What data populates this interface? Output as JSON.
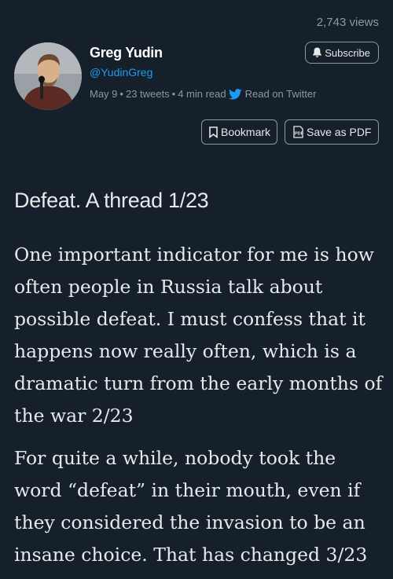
{
  "thread": {
    "views": "2,743 views",
    "author": {
      "name": "Greg Yudin",
      "handle": "@YudinGreg"
    },
    "meta": {
      "date": "May 9",
      "tweets": "23 tweets",
      "read_time": "4 min read",
      "read_on": "Read on Twitter",
      "separator": "•"
    },
    "buttons": {
      "subscribe": "Subscribe",
      "bookmark": "Bookmark",
      "save_pdf": "Save as PDF"
    },
    "title": "Defeat. A thread 1/23",
    "paragraphs": [
      "One important indicator for me is how often people in Russia talk about possible defeat. I must confess that it happens now really often, which is a dramatic turn from the early months of the war 2/23",
      "For quite a while, nobody took the word “defeat” in their mouth, even if they considered the invasion to be an insane choice. That has changed 3/23"
    ]
  },
  "colors": {
    "background": "#15202b",
    "text": "#e7e9ea",
    "muted": "#8b98a5",
    "link": "#1d9bf0"
  },
  "icons": {
    "subscribe": "bell-icon",
    "bookmark": "bookmark-icon",
    "save_pdf": "pdf-icon",
    "twitter": "twitter-bird-icon"
  }
}
